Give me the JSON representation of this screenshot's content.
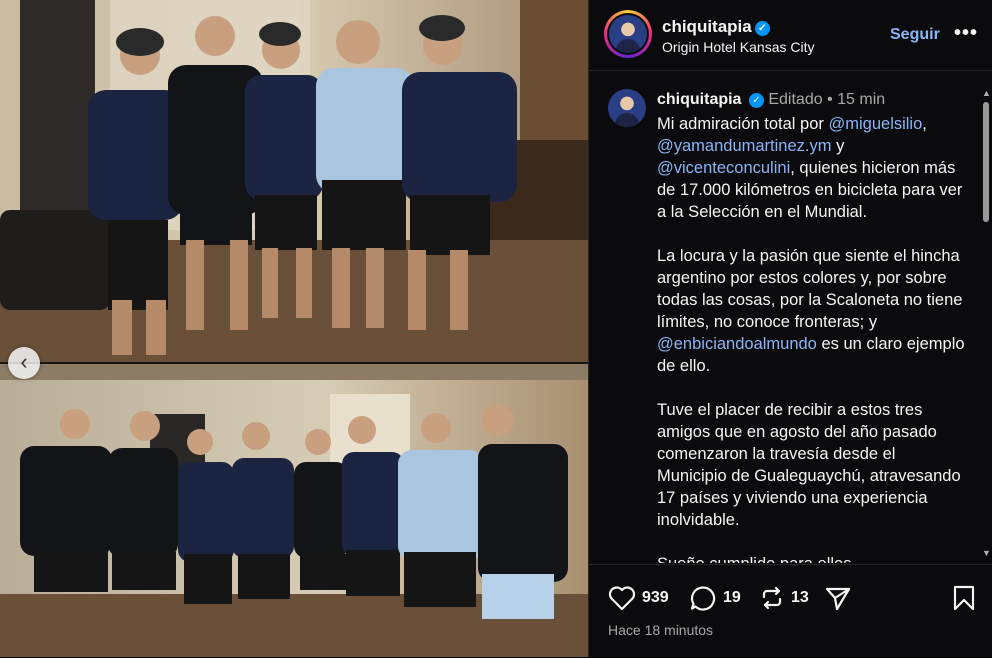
{
  "header": {
    "username": "chiquitapia",
    "location": "Origin Hotel Kansas City",
    "follow_label": "Seguir",
    "more_label": "•••"
  },
  "comment": {
    "username": "chiquitapia",
    "edited_label": "Editado",
    "separator": "•",
    "time": "15 min",
    "paragraphs": [
      [
        {
          "t": "Mi admiración total por ",
          "m": false
        },
        {
          "t": "@miguelsilio",
          "m": true
        },
        {
          "t": ", ",
          "m": false
        },
        {
          "t": "@yamandumartinez.ym",
          "m": true
        },
        {
          "t": " y ",
          "m": false
        },
        {
          "t": "@vicenteconculini",
          "m": true
        },
        {
          "t": ", quienes hicieron más de 17.000 kilómetros en bicicleta para ver a la Selección en el Mundial.",
          "m": false
        }
      ],
      [
        {
          "t": "La locura y la pasión que siente el hincha argentino por estos colores y, por sobre todas las cosas, por la Scaloneta no tiene límites, no conoce fronteras; y ",
          "m": false
        },
        {
          "t": "@enbiciandoalmundo",
          "m": true
        },
        {
          "t": " es un claro ejemplo de ello.",
          "m": false
        }
      ],
      [
        {
          "t": "Tuve el placer de recibir a estos tres amigos que en agosto del año pasado comenzaron la travesía desde el Municipio de Gualeguaychú, atravesando 17 países y viviendo una experiencia inolvidable.",
          "m": false
        }
      ],
      [
        {
          "t": "Sueño cumplido para ellos...",
          "m": false
        }
      ]
    ]
  },
  "footer": {
    "likes": "939",
    "comments": "19",
    "reposts": "13",
    "time_ago": "Hace 18 minutos"
  },
  "icons": {
    "verified": "verified-badge-icon",
    "like": "heart-icon",
    "comment": "comment-bubble-icon",
    "repost": "repost-icon",
    "share": "send-icon",
    "save": "bookmark-icon",
    "carousel_prev": "chevron-left-icon"
  },
  "colors": {
    "accent": "#0095f6",
    "link": "#8ab4f8",
    "muted": "#a8a8a8",
    "background": "#0b0b0d"
  }
}
